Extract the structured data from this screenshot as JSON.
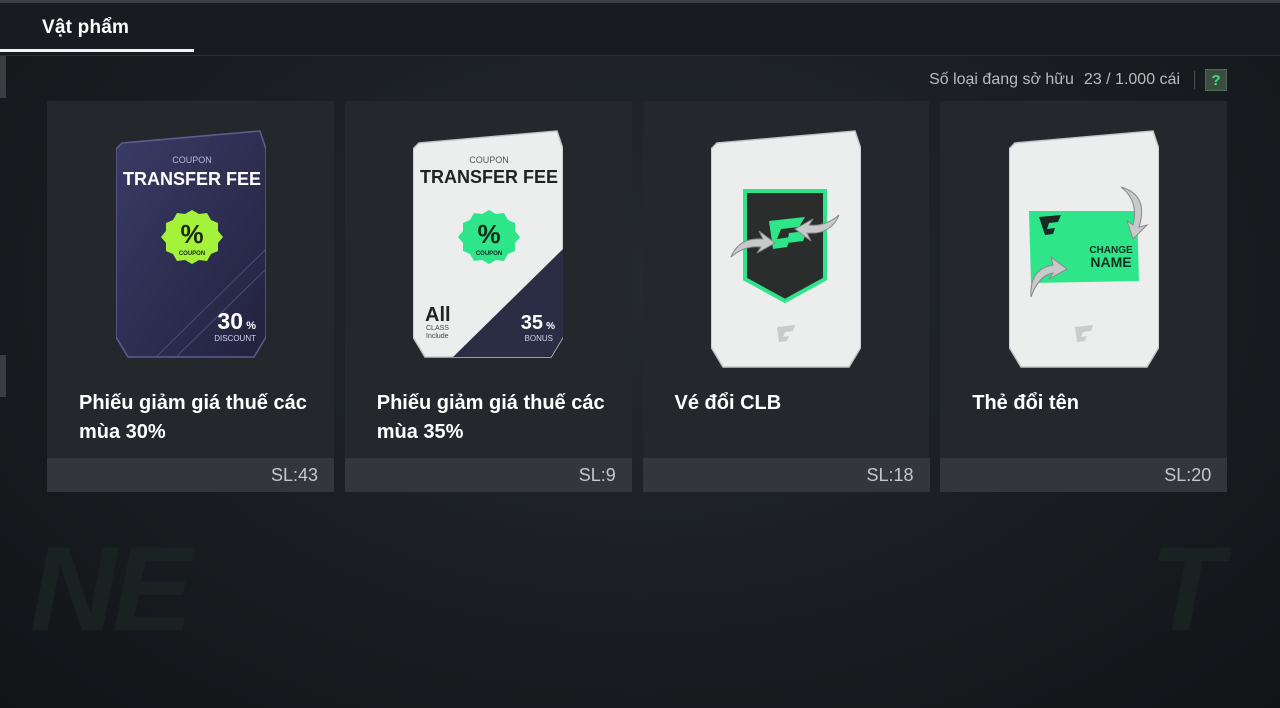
{
  "header": {
    "tab_label": "Vật phẩm"
  },
  "inventory": {
    "owned_label": "Số loại đang sở hữu",
    "owned_value": "23 / 1.000 cái",
    "help_symbol": "?"
  },
  "items": [
    {
      "title": "Phiếu giảm giá thuế các mùa 30%",
      "quantity": "SL:43",
      "art": {
        "coupon_label": "COUPON",
        "heading": "TRANSFER FEE",
        "badge_symbol": "%",
        "badge_label": "COUPON",
        "percent": "30",
        "percent_unit": "%",
        "percent_caption": "DISCOUNT"
      }
    },
    {
      "title": "Phiếu giảm giá thuế các mùa 35%",
      "quantity": "SL:9",
      "art": {
        "coupon_label": "COUPON",
        "heading": "TRANSFER FEE",
        "badge_symbol": "%",
        "badge_label": "COUPON",
        "class_big": "All",
        "class_line1": "CLASS",
        "class_line2": "Include",
        "percent": "35",
        "percent_unit": "%",
        "percent_caption": "BONUS"
      }
    },
    {
      "title": "Vé đổi CLB",
      "quantity": "SL:18",
      "art": {}
    },
    {
      "title": "Thẻ đổi tên",
      "quantity": "SL:20",
      "art": {
        "line1": "CHANGE",
        "line2": "NAME"
      }
    }
  ],
  "colors": {
    "accent_green": "#2ee58a",
    "badge_lime": "#a4f23a",
    "dark_card": "#2c2d4e"
  }
}
